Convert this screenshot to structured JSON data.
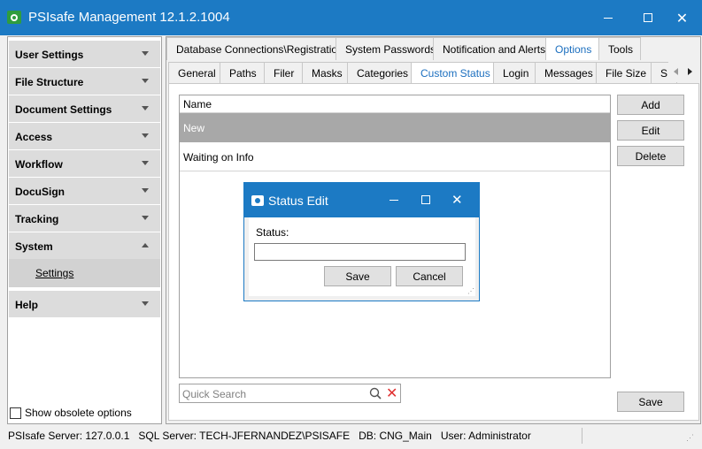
{
  "window": {
    "title": "PSIsafe Management 12.1.2.1004"
  },
  "sidebar": {
    "groups": [
      {
        "label": "User Settings",
        "expanded": false
      },
      {
        "label": "File Structure",
        "expanded": false
      },
      {
        "label": "Document Settings",
        "expanded": false
      },
      {
        "label": "Access",
        "expanded": false
      },
      {
        "label": "Workflow",
        "expanded": false
      },
      {
        "label": "DocuSign",
        "expanded": false
      },
      {
        "label": "Tracking",
        "expanded": false
      },
      {
        "label": "System",
        "expanded": true
      },
      {
        "label": "Help",
        "expanded": false
      }
    ],
    "system_items": [
      "Settings"
    ],
    "show_obsolete_label": "Show obsolete options",
    "show_obsolete_checked": false
  },
  "tabs_top": {
    "items": [
      "Database Connections\\Registration",
      "System Passwords",
      "Notification and Alerts",
      "Options",
      "Tools"
    ],
    "active": "Options"
  },
  "tabs_sub": {
    "items": [
      "General",
      "Paths",
      "Filer",
      "Masks",
      "Categories",
      "Custom Status",
      "Login",
      "Messages",
      "File Size",
      "S"
    ],
    "active": "Custom Status"
  },
  "status_list": {
    "column_header": "Name",
    "rows": [
      "New",
      "Waiting on Info"
    ],
    "selected": "New"
  },
  "buttons": {
    "add": "Add",
    "edit": "Edit",
    "delete": "Delete",
    "save": "Save"
  },
  "search": {
    "placeholder": "Quick Search"
  },
  "dialog": {
    "title": "Status Edit",
    "label": "Status:",
    "value": "",
    "save": "Save",
    "cancel": "Cancel"
  },
  "statusbar": {
    "text": "PSIsafe Server: 127.0.0.1   SQL Server: TECH-JFERNANDEZ\\PSISAFE   DB: CNG_Main   User: Administrator"
  },
  "colors": {
    "accent": "#1c7ac4",
    "selected_row": "#a8a8a8",
    "nav_group_bg": "#dcdcdc",
    "delete_icon": "#e03030"
  }
}
